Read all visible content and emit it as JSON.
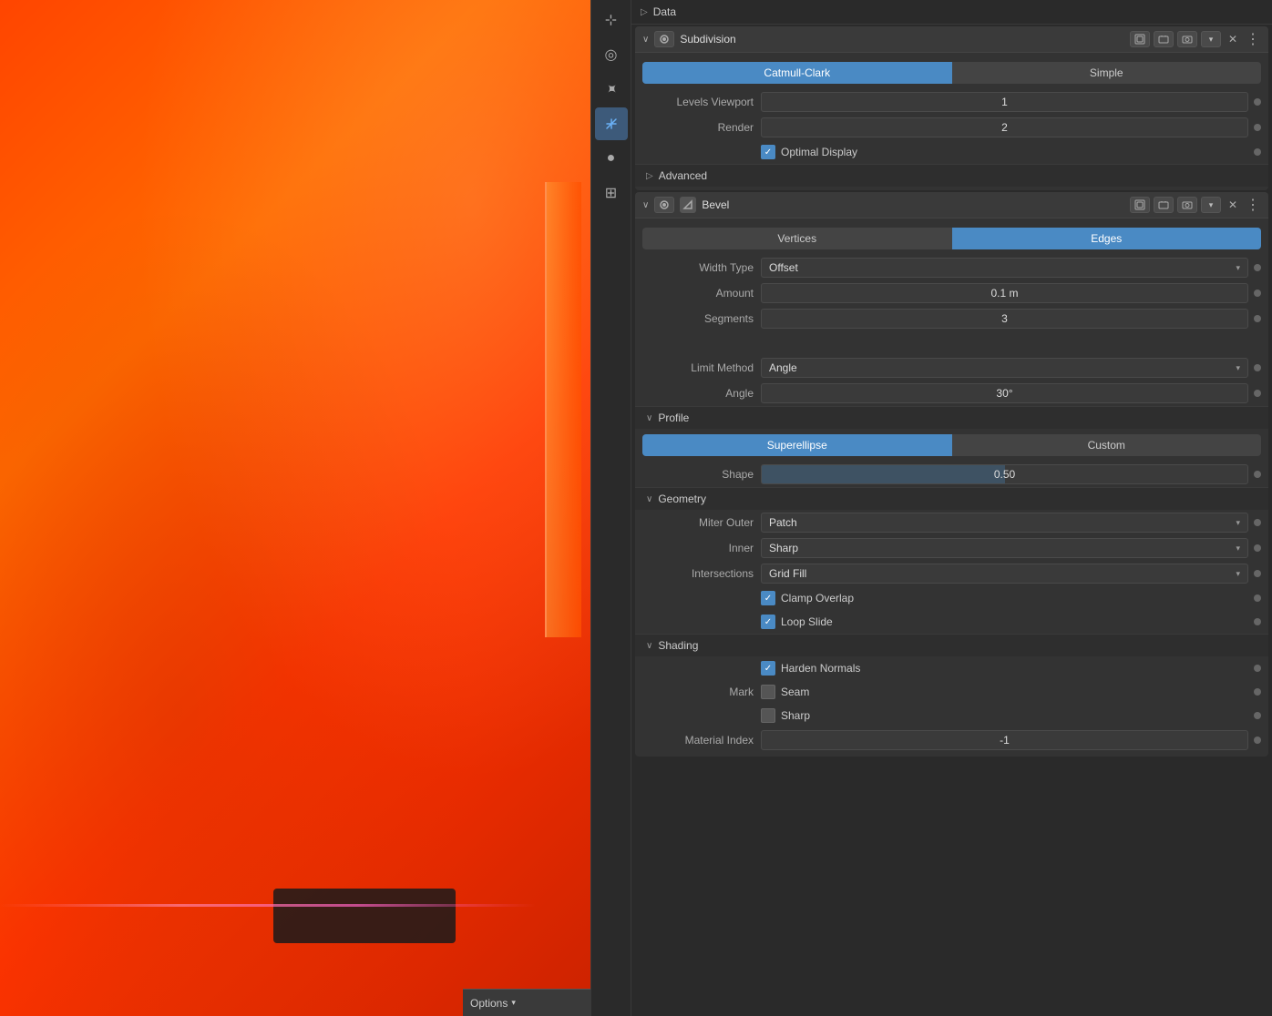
{
  "viewport": {
    "options_label": "Options"
  },
  "sidebar": {
    "icons": [
      {
        "name": "cursor-icon",
        "symbol": "⊹",
        "active": false
      },
      {
        "name": "orbit-icon",
        "symbol": "◎",
        "active": false
      },
      {
        "name": "move-icon",
        "symbol": "⊕",
        "active": false
      },
      {
        "name": "modifier-icon-btn",
        "symbol": "⛉",
        "active": true
      },
      {
        "name": "material-icon",
        "symbol": "●",
        "active": false
      },
      {
        "name": "render-icon",
        "symbol": "⊞",
        "active": false
      }
    ]
  },
  "properties": {
    "data_section": {
      "label": "Data",
      "arrow": "▷"
    },
    "subdivision": {
      "header": {
        "name": "Subdivision",
        "expand_arrow": "∨",
        "icon": "▦"
      },
      "tabs": {
        "left": "Catmull-Clark",
        "right": "Simple",
        "active": "left"
      },
      "fields": [
        {
          "label": "Levels Viewport",
          "value": "1",
          "type": "number"
        },
        {
          "label": "Render",
          "value": "2",
          "type": "number"
        }
      ],
      "optimal_display": {
        "label": "Optimal Display",
        "checked": true
      },
      "advanced": {
        "label": "Advanced",
        "arrow": "▷"
      }
    },
    "bevel": {
      "header": {
        "name": "Bevel",
        "expand_arrow": "∨",
        "icon": "◪"
      },
      "tabs": {
        "left": "Vertices",
        "right": "Edges",
        "active": "right"
      },
      "fields": [
        {
          "label": "Width Type",
          "value": "Offset",
          "type": "dropdown"
        },
        {
          "label": "Amount",
          "value": "0.1 m",
          "type": "number"
        },
        {
          "label": "Segments",
          "value": "3",
          "type": "number"
        },
        {
          "label": "Limit Method",
          "value": "Angle",
          "type": "dropdown"
        },
        {
          "label": "Angle",
          "value": "30°",
          "type": "number"
        }
      ],
      "profile_section": {
        "label": "Profile",
        "arrow": "∨",
        "tabs": {
          "left": "Superellipse",
          "right": "Custom",
          "active": "left"
        },
        "shape": {
          "label": "Shape",
          "value": "0.50",
          "type": "slider"
        }
      },
      "geometry_section": {
        "label": "Geometry",
        "arrow": "∨",
        "fields": [
          {
            "label": "Miter Outer",
            "value": "Patch",
            "type": "dropdown"
          },
          {
            "label": "Inner",
            "value": "Sharp",
            "type": "dropdown"
          },
          {
            "label": "Intersections",
            "value": "Grid Fill",
            "type": "dropdown"
          }
        ],
        "checkboxes": [
          {
            "label": "Clamp Overlap",
            "checked": true
          },
          {
            "label": "Loop Slide",
            "checked": true
          }
        ]
      },
      "shading_section": {
        "label": "Shading",
        "arrow": "∨",
        "checkboxes": [
          {
            "label": "Harden Normals",
            "checked": true,
            "standalone": true
          }
        ],
        "mark_fields": [
          {
            "label": "Seam",
            "checked": false
          },
          {
            "label": "Sharp",
            "checked": false
          }
        ],
        "mark_label": "Mark",
        "material_index": {
          "label": "Material Index",
          "value": "-1"
        }
      }
    }
  }
}
